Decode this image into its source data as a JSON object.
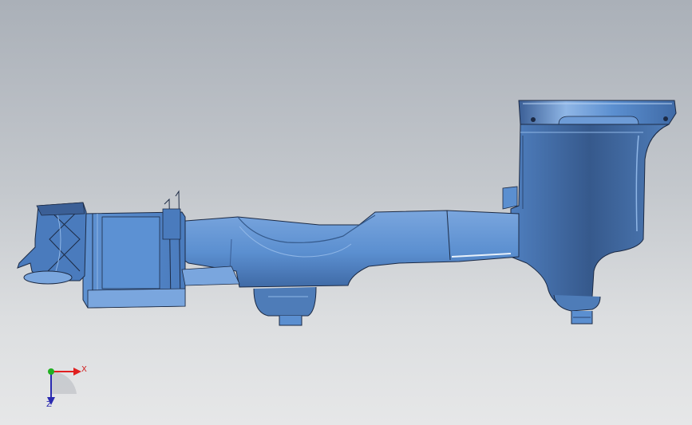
{
  "viewport": {
    "background_top": "#aab0b8",
    "background_bottom": "#e6e7e8"
  },
  "model": {
    "part_color": "#5b8fd0",
    "shadow_color": "#3a5f95",
    "highlight_color": "#8fb6e6",
    "edge_color": "#1c2a44"
  },
  "triad": {
    "x_label": "X",
    "z_label": "Z",
    "x_color": "#e02020",
    "y_color": "#20b020",
    "z_color": "#2a2ab0"
  }
}
